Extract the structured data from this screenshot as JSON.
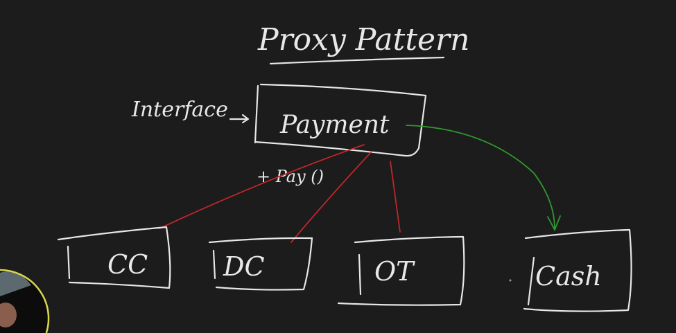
{
  "title": "Proxy Pattern",
  "interface_label": "Interface",
  "interface_node": {
    "label": "Payment",
    "method": "+ Pay ()"
  },
  "implementations": [
    {
      "label": "CC"
    },
    {
      "label": "DC"
    },
    {
      "label": "OT"
    }
  ],
  "proxy_node": {
    "label": "Cash"
  },
  "colors": {
    "background": "#1c1c1c",
    "chalk": "#e6e6e6",
    "implements_edge": "#c0262a",
    "proxy_edge": "#2f9a2f",
    "webcam_ring": "#d8d84a"
  }
}
